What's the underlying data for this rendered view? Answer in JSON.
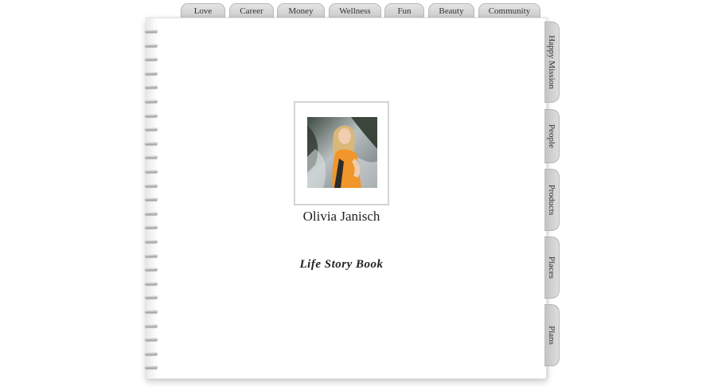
{
  "top_tabs": [
    "Love",
    "Career",
    "Money",
    "Wellness",
    "Fun",
    "Beauty",
    "Community"
  ],
  "side_tabs": [
    "Happy Mission",
    "People",
    "Products",
    "Places",
    "Plans"
  ],
  "profile": {
    "name": "Olivia Janisch",
    "subtitle": "Life Story Book"
  }
}
